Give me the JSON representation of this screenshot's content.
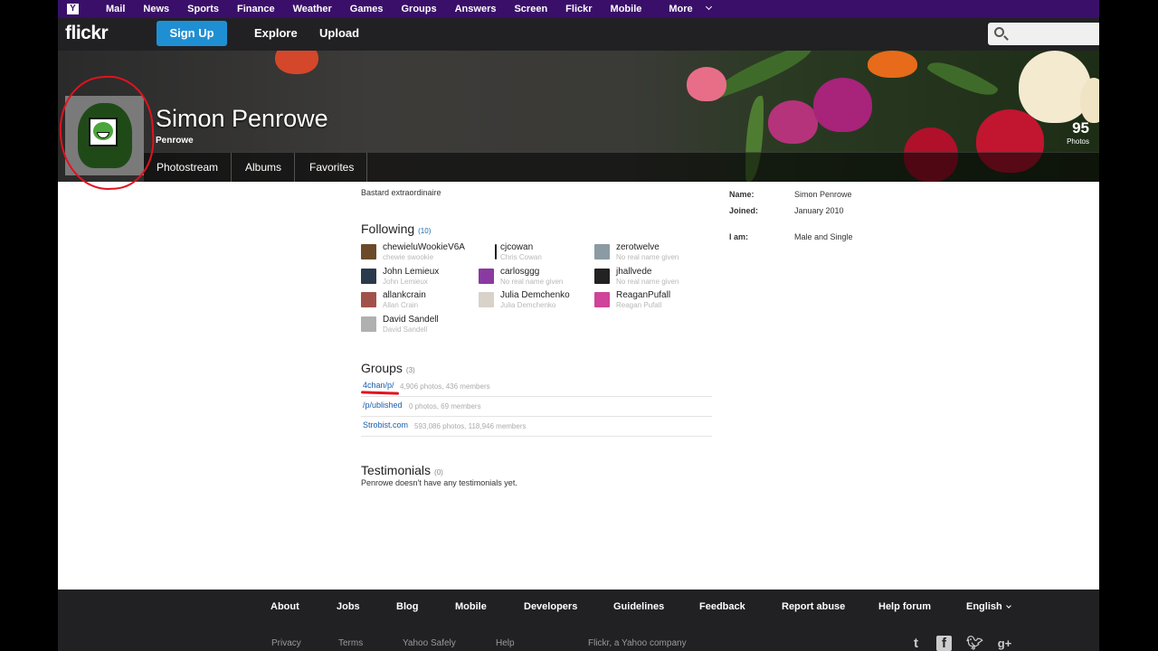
{
  "yahoo_bar": {
    "links": [
      "Mail",
      "News",
      "Sports",
      "Finance",
      "Weather",
      "Games",
      "Groups",
      "Answers",
      "Screen",
      "Flickr",
      "Mobile"
    ],
    "more_label": "More"
  },
  "header": {
    "logo": "flickr",
    "signup_label": "Sign Up",
    "explore_label": "Explore",
    "upload_label": "Upload",
    "search_placeholder": ""
  },
  "profile": {
    "display_name": "Simon Penrowe",
    "username": "Penrowe",
    "photo_count": "95",
    "photo_count_label": "Photos",
    "tabs": [
      "Photostream",
      "Albums",
      "Favorites"
    ],
    "tagline": "Bastard extraordinaire"
  },
  "following": {
    "title": "Following",
    "count": "(10)",
    "people": [
      {
        "name": "chewieluWookieV6A",
        "real": "chewie swookie",
        "color": "#6b4a2a"
      },
      {
        "name": "cjcowan",
        "real": "Chris Cowan",
        "color": "#ffffff"
      },
      {
        "name": "zerotwelve",
        "real": "No real name given",
        "color": "#8c9aa3"
      },
      {
        "name": "John Lemieux",
        "real": "John Lemieux",
        "color": "#2a3a4a"
      },
      {
        "name": "carlosggg",
        "real": "No real name given",
        "color": "#8a3aa0"
      },
      {
        "name": "jhallvede",
        "real": "No real name given",
        "color": "#222222"
      },
      {
        "name": "allankcrain",
        "real": "Allan Crain",
        "color": "#a0524a"
      },
      {
        "name": "Julia Demchenko",
        "real": "Julia Demchenko",
        "color": "#d9d2c8"
      },
      {
        "name": "ReaganPufall",
        "real": "Reagan Pufall",
        "color": "#d0439a"
      },
      {
        "name": "David Sandell",
        "real": "David Sandell",
        "color": "#b0b0b0"
      }
    ]
  },
  "groups": {
    "title": "Groups",
    "count": "(3)",
    "items": [
      {
        "name": "4chan/p/",
        "stats": "4,906 photos, 436 members"
      },
      {
        "name": "/p/ublished",
        "stats": "0 photos, 69 members"
      },
      {
        "name": "Strobist.com",
        "stats": "593,086 photos, 118,946 members"
      }
    ]
  },
  "testimonials": {
    "title": "Testimonials",
    "count": "(0)",
    "text": "Penrowe doesn't have any testimonials yet."
  },
  "meta": {
    "name_label": "Name:",
    "name_value": "Simon Penrowe",
    "joined_label": "Joined:",
    "joined_value": "January 2010",
    "iam_label": "I am:",
    "iam_value": "Male and Single"
  },
  "footer": {
    "links": [
      "About",
      "Jobs",
      "Blog",
      "Mobile",
      "Developers",
      "Guidelines",
      "Feedback",
      "Report abuse",
      "Help forum"
    ],
    "language": "English",
    "secondary": [
      "Privacy",
      "Terms",
      "Yahoo Safely",
      "Help"
    ],
    "company": "Flickr, a Yahoo company",
    "social": [
      "tumblr-icon",
      "facebook-icon",
      "twitter-icon",
      "google-plus-icon"
    ]
  },
  "annotation_color": "#e3121e"
}
